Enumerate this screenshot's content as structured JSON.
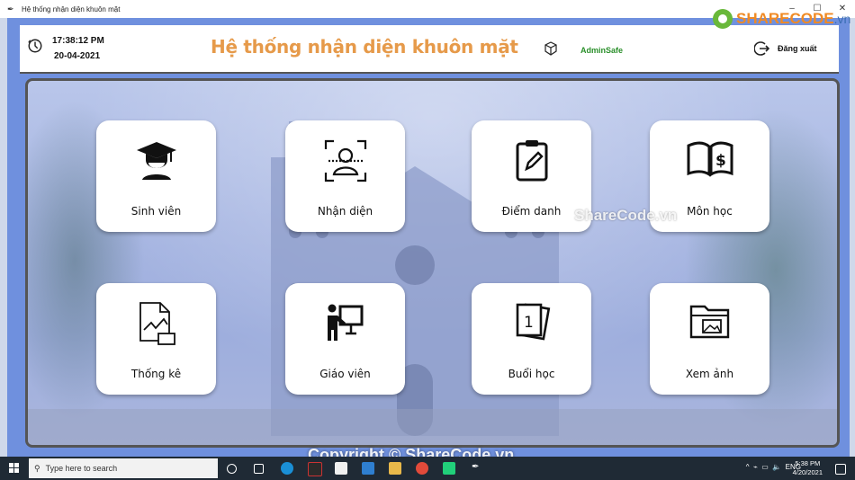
{
  "window": {
    "title": "Hệ thống nhận diện khuôn mặt",
    "controls": [
      "–",
      "☐",
      "✕"
    ]
  },
  "header": {
    "time": "17:38:12 PM",
    "date": "20-04-2021",
    "app_title": "Hệ thống nhận diện khuôn mặt",
    "username": "AdminSafe",
    "logout_label": "Đăng xuất"
  },
  "tiles": [
    {
      "label": "Sinh viên",
      "icon": "graduate-icon"
    },
    {
      "label": "Nhận diện",
      "icon": "face-scan-icon"
    },
    {
      "label": "Điểm danh",
      "icon": "clipboard-edit-icon"
    },
    {
      "label": "Môn học",
      "icon": "book-dollar-icon"
    },
    {
      "label": "Thống kê",
      "icon": "report-chart-icon"
    },
    {
      "label": "Giáo viên",
      "icon": "teacher-board-icon"
    },
    {
      "label": "Buổi học",
      "icon": "cards-one-icon"
    },
    {
      "label": "Xem ảnh",
      "icon": "image-folder-icon"
    }
  ],
  "watermarks": {
    "center": "ShareCode.vn",
    "bottom": "Copyright © ShareCode.vn",
    "logo_main": "SHARECODE",
    "logo_sub": ".vn"
  },
  "taskbar": {
    "search_placeholder": "Type here to search",
    "tray_lang": "ENG",
    "clock_time": "5:38 PM",
    "clock_date": "4/20/2021"
  },
  "colors": {
    "title": "#e69a4a",
    "username": "#2a8f2a",
    "frame": "#6f90de"
  }
}
